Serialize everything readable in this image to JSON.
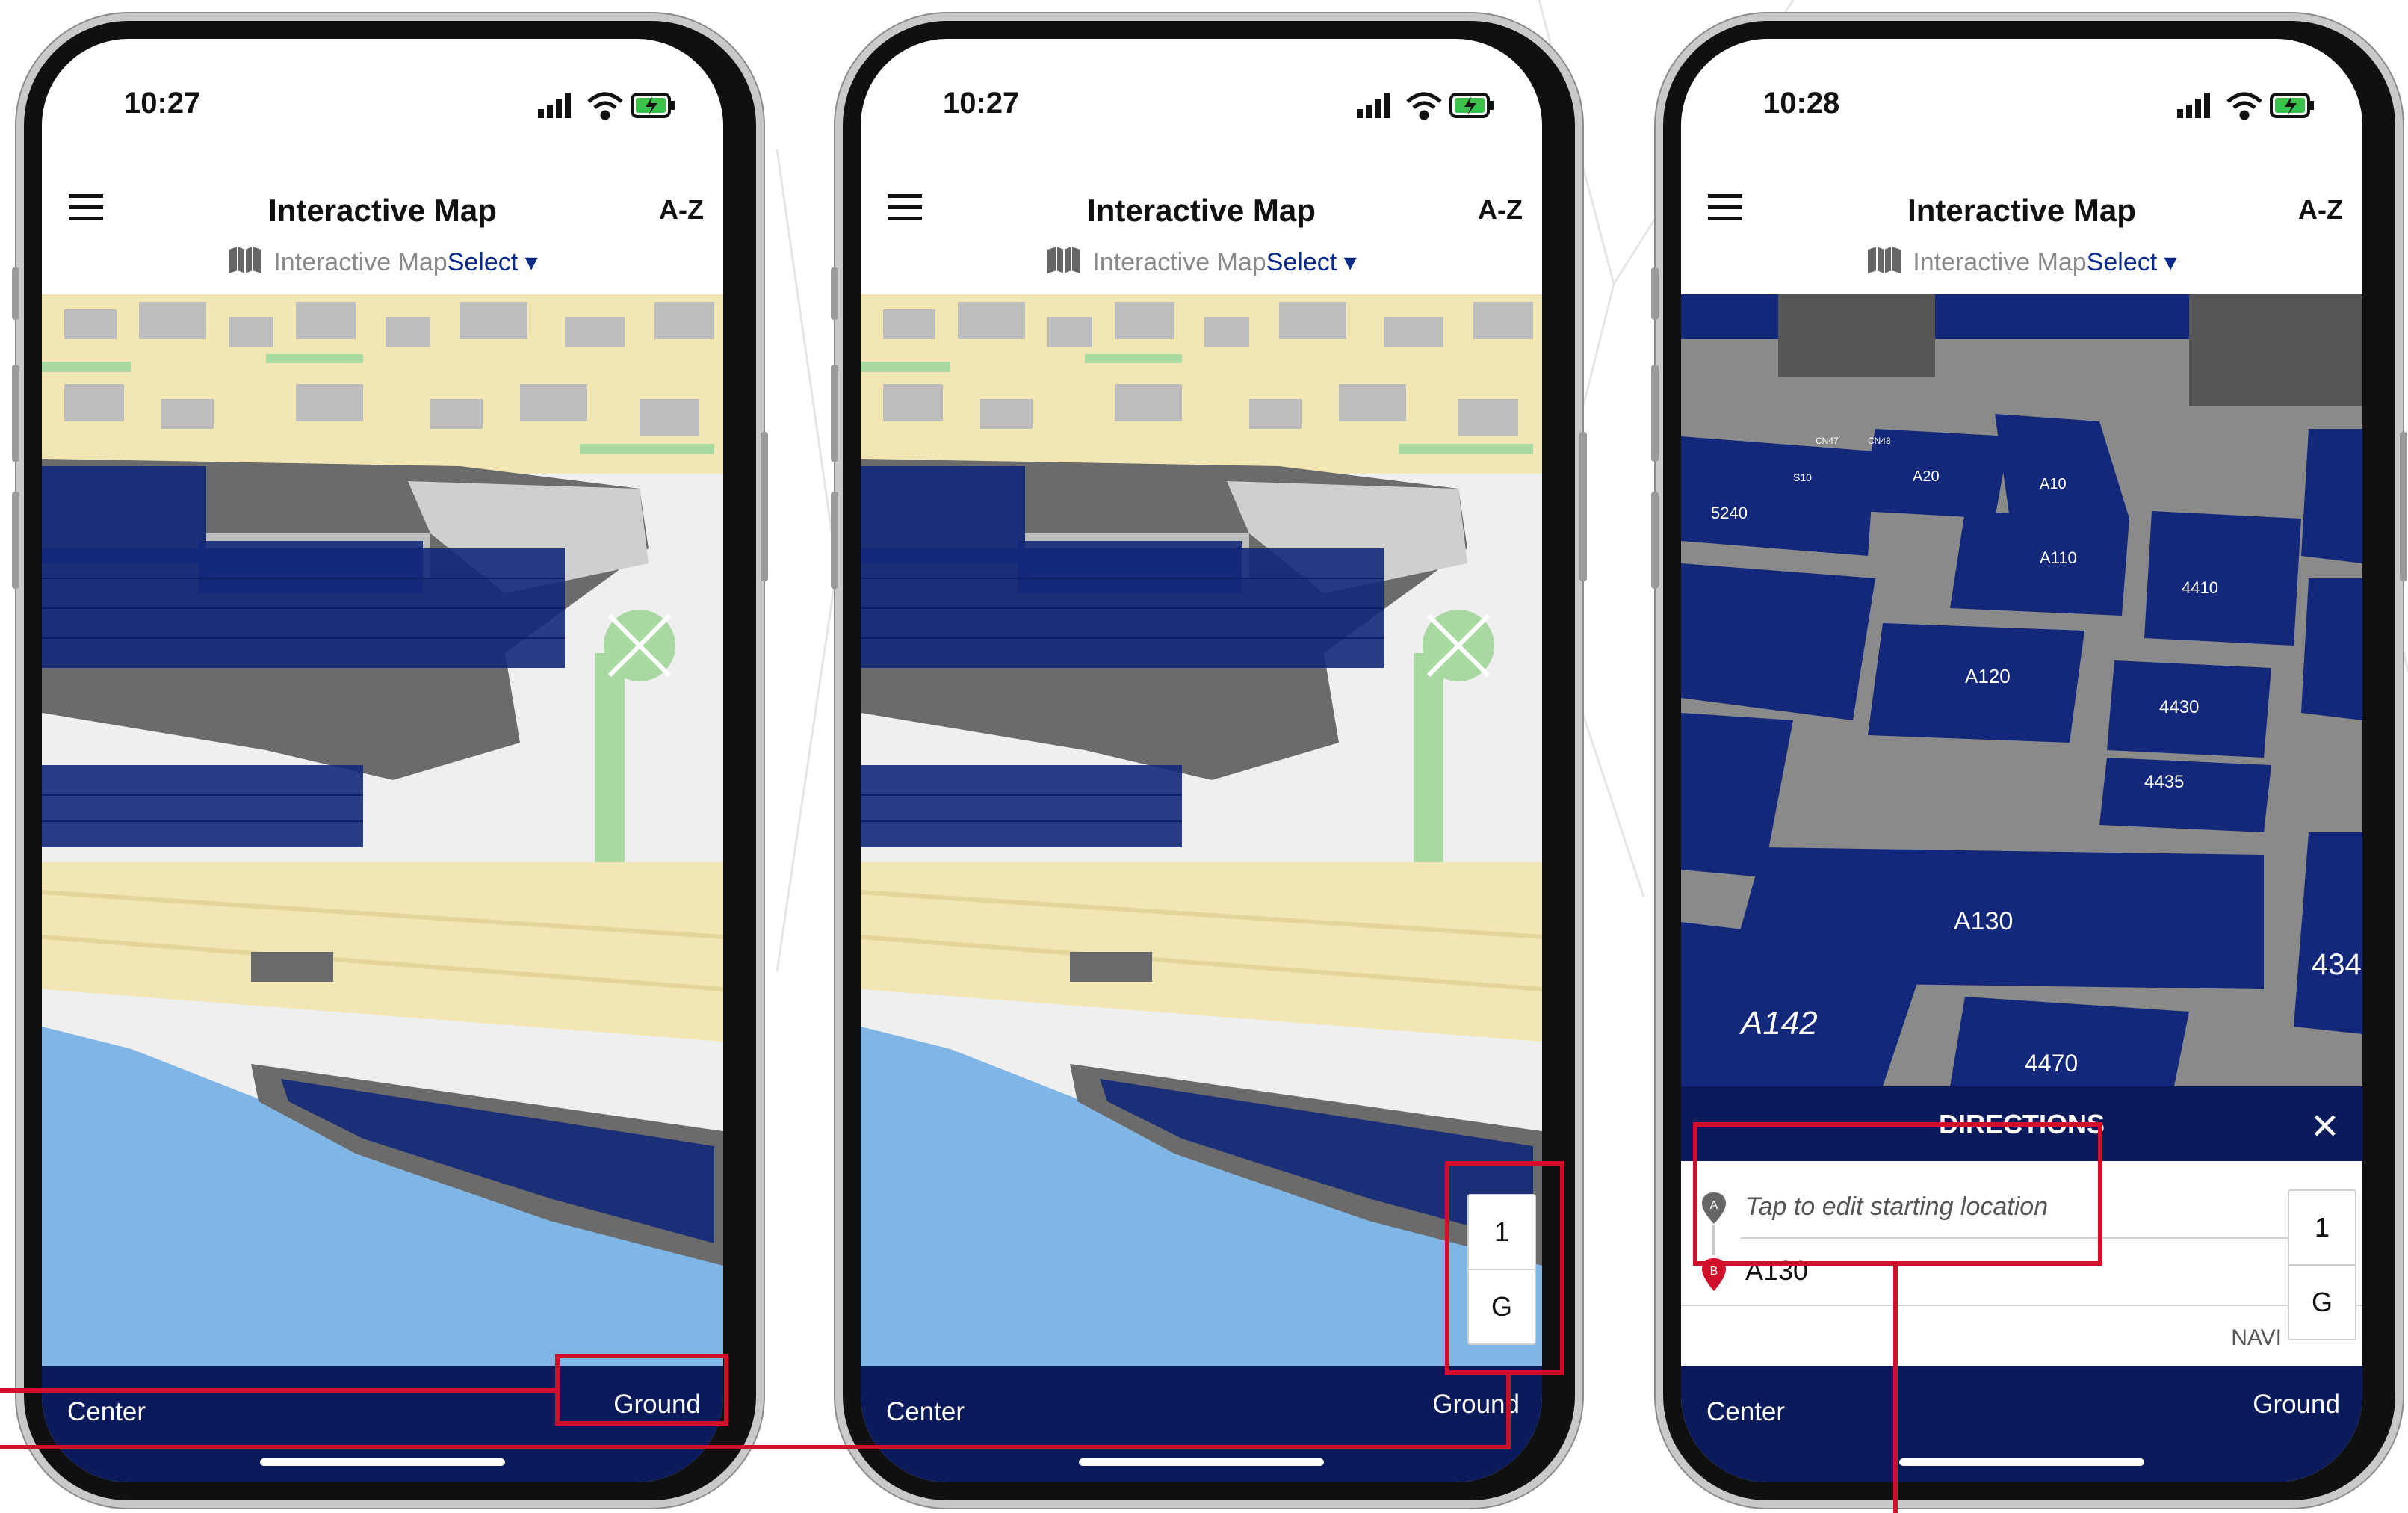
{
  "screens": [
    {
      "status": {
        "time": "10:27"
      },
      "appbar": {
        "title": "Interactive Map",
        "az": "A-Z",
        "sub_prefix": "Interactive Map",
        "sub_select": "Select ▾"
      },
      "bottom": {
        "center": "Center",
        "ground": "Ground"
      }
    },
    {
      "status": {
        "time": "10:27"
      },
      "appbar": {
        "title": "Interactive Map",
        "az": "A-Z",
        "sub_prefix": "Interactive Map",
        "sub_select": "Select ▾"
      },
      "floors": [
        "1",
        "G"
      ],
      "bottom": {
        "center": "Center",
        "ground": "Ground"
      }
    },
    {
      "status": {
        "time": "10:28"
      },
      "appbar": {
        "title": "Interactive Map",
        "az": "A-Z",
        "sub_prefix": "Interactive Map",
        "sub_select": "Select ▾"
      },
      "map_labels": [
        "A20",
        "A10",
        "A110",
        "4410",
        "A120",
        "4430",
        "4435",
        "A130",
        "A142",
        "4470",
        "434",
        "5240",
        "S10",
        "CN47",
        "CN48"
      ],
      "directions": {
        "title": "DIRECTIONS",
        "close": "✕",
        "start_placeholder": "Tap to edit starting location",
        "destination": "A130",
        "navi": "NAVI",
        "pin_a": "A",
        "pin_b": "B"
      },
      "floors": [
        "1",
        "G"
      ],
      "bottom": {
        "center": "Center",
        "ground": "Ground"
      }
    }
  ],
  "colors": {
    "brand_navy": "#0b1a5a",
    "booth_blue": "#13287a",
    "callout_red": "#d0102a",
    "water": "#7fb6e6",
    "sand": "#f3e6b5",
    "road": "#ececec",
    "park": "#a8d9a0"
  },
  "icons": [
    "menu-icon",
    "signal-icon",
    "wifi-icon",
    "battery-charging-icon",
    "map-icon",
    "close-icon",
    "pin-a-icon",
    "pin-b-icon"
  ]
}
